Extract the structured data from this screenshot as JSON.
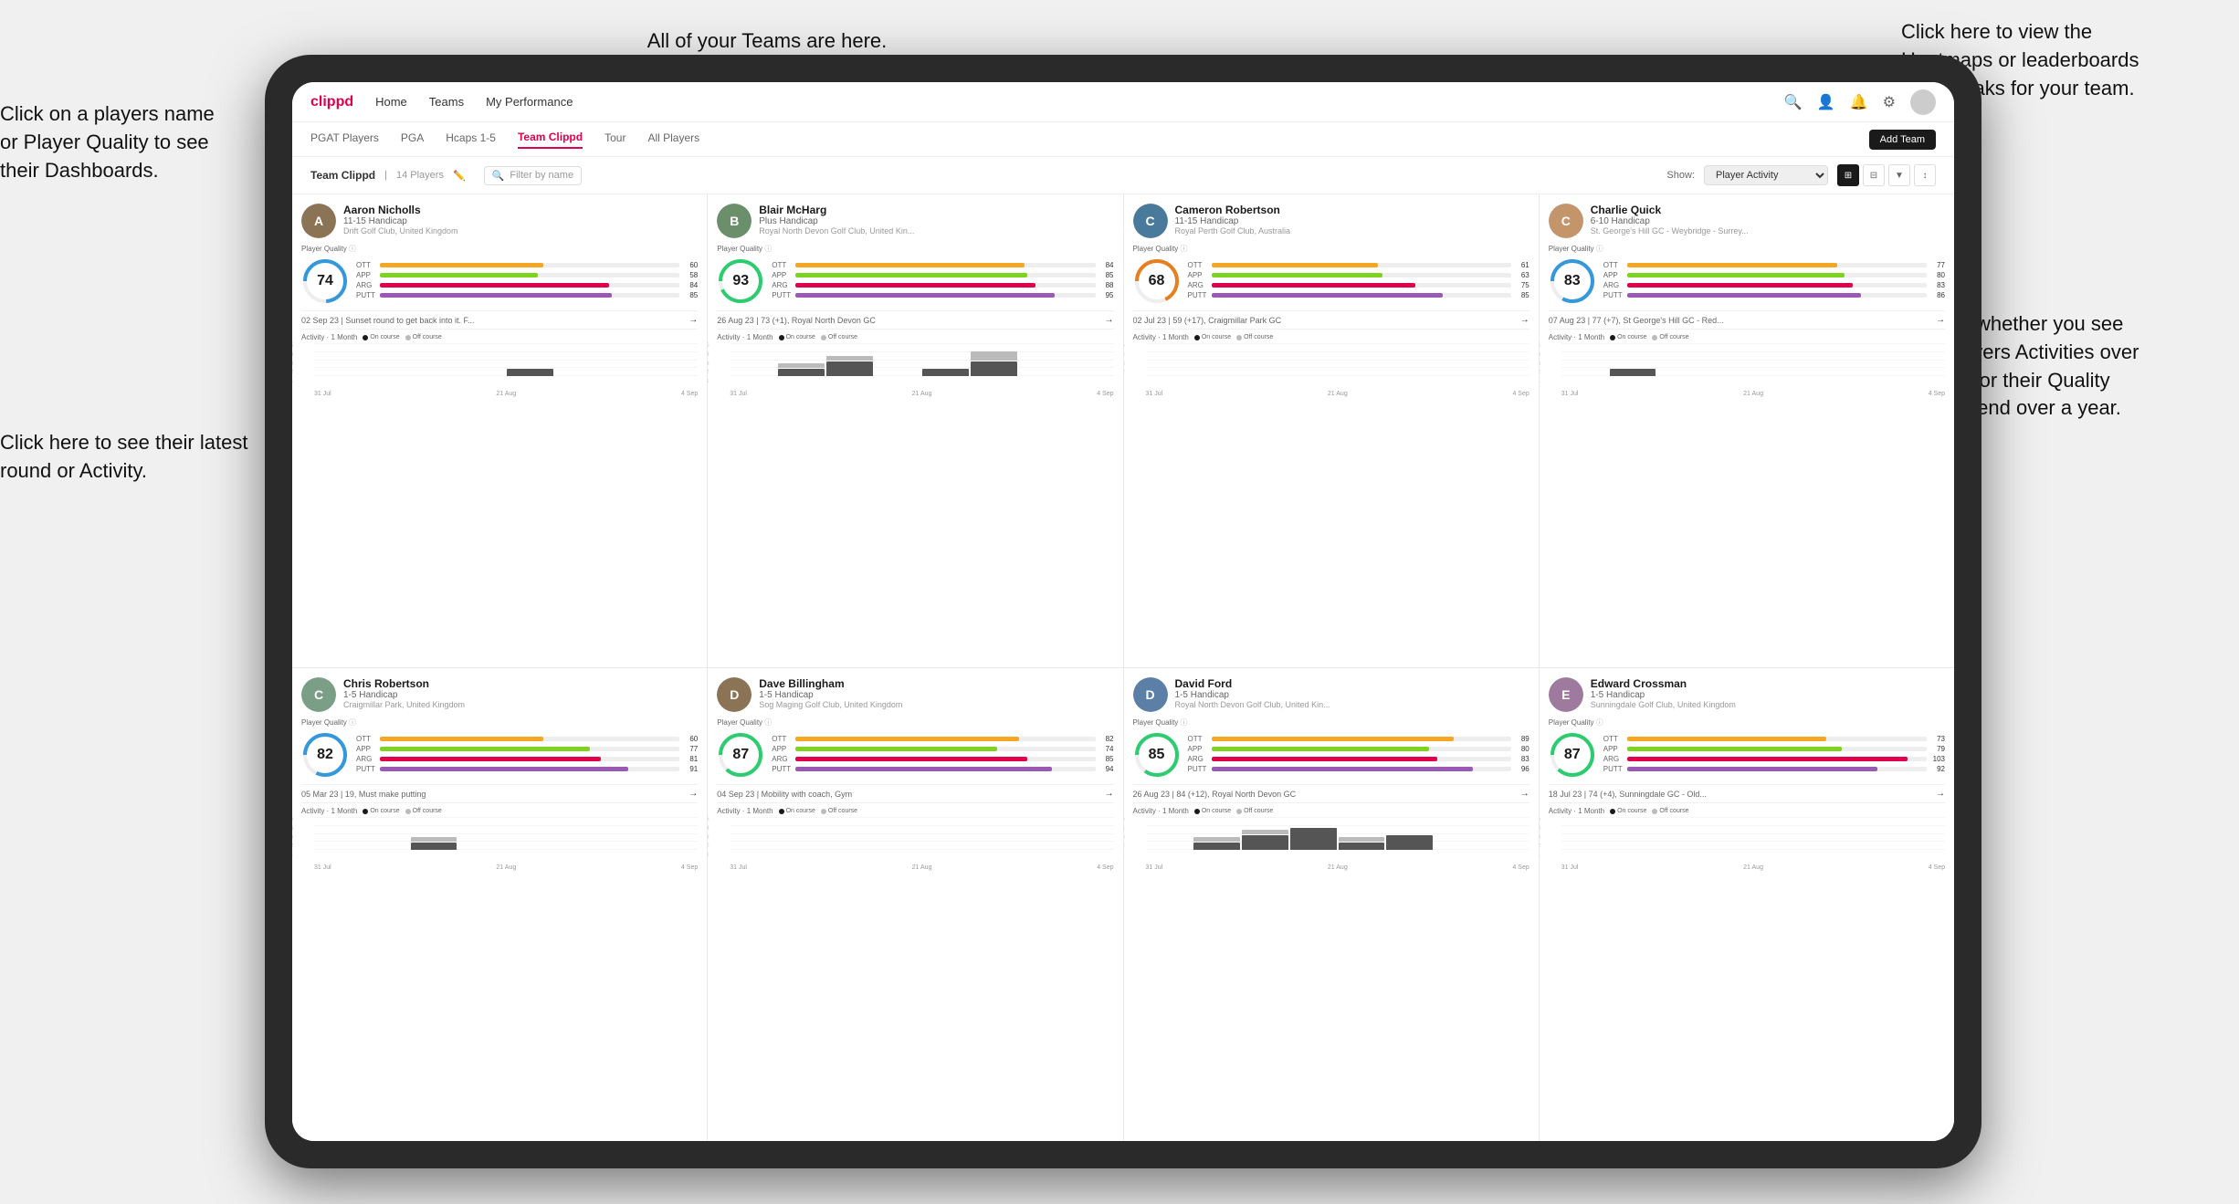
{
  "annotations": {
    "left1": "Click on a players name\nor Player Quality to see\ntheir Dashboards.",
    "left2": "Click here to see their latest\nround or Activity.",
    "top": "All of your Teams are here.",
    "topright": "Click here to view the\nHeatmaps or leaderboards\nand streaks for your team.",
    "right": "Choose whether you see\nyour players Activities over\na month or their Quality\nScore Trend over a year."
  },
  "nav": {
    "logo": "clippd",
    "items": [
      "Home",
      "Teams",
      "My Performance"
    ],
    "add_team": "Add Team"
  },
  "tabs": {
    "items": [
      "PGAT Players",
      "PGA",
      "Hcaps 1-5",
      "Team Clippd",
      "Tour",
      "All Players"
    ],
    "active": "Team Clippd"
  },
  "team_header": {
    "title": "Team Clippd",
    "count": "14 Players",
    "filter_placeholder": "Filter by name",
    "show_label": "Show:",
    "show_value": "Player Activity"
  },
  "players": [
    {
      "name": "Aaron Nicholls",
      "handicap": "11-15 Handicap",
      "club": "Drift Golf Club, United Kingdom",
      "quality": 74,
      "ott": 60,
      "app": 58,
      "arg": 84,
      "putt": 85,
      "latest_round": "02 Sep 23 | Sunset round to get back into it. F...",
      "bars": [
        {
          "week": "31 Jul",
          "on": 0,
          "off": 0
        },
        {
          "week": "",
          "on": 0,
          "off": 0
        },
        {
          "week": "",
          "on": 0,
          "off": 0
        },
        {
          "week": "",
          "on": 0,
          "off": 0
        },
        {
          "week": "",
          "on": 1,
          "off": 0
        },
        {
          "week": "21 Aug",
          "on": 0,
          "off": 0
        },
        {
          "week": "",
          "on": 0,
          "off": 0
        },
        {
          "week": "4 Sep",
          "on": 0,
          "off": 0
        }
      ],
      "avatar_color": "#8B7355"
    },
    {
      "name": "Blair McHarg",
      "handicap": "Plus Handicap",
      "club": "Royal North Devon Golf Club, United Kin...",
      "quality": 93,
      "ott": 84,
      "app": 85,
      "arg": 88,
      "putt": 95,
      "latest_round": "26 Aug 23 | 73 (+1), Royal North Devon GC",
      "bars": [
        {
          "week": "31 Jul",
          "on": 0,
          "off": 0
        },
        {
          "week": "",
          "on": 1,
          "off": 1
        },
        {
          "week": "",
          "on": 2,
          "off": 1
        },
        {
          "week": "",
          "on": 0,
          "off": 0
        },
        {
          "week": "",
          "on": 1,
          "off": 0
        },
        {
          "week": "21 Aug",
          "on": 2,
          "off": 2
        },
        {
          "week": "",
          "on": 0,
          "off": 0
        },
        {
          "week": "4 Sep",
          "on": 0,
          "off": 0
        }
      ],
      "avatar_color": "#6B8E6B"
    },
    {
      "name": "Cameron Robertson",
      "handicap": "11-15 Handicap",
      "club": "Royal Perth Golf Club, Australia",
      "quality": 68,
      "ott": 61,
      "app": 63,
      "arg": 75,
      "putt": 85,
      "latest_round": "02 Jul 23 | 59 (+17), Craigmillar Park GC",
      "bars": [
        {
          "week": "31 Jul",
          "on": 0,
          "off": 0
        },
        {
          "week": "",
          "on": 0,
          "off": 0
        },
        {
          "week": "",
          "on": 0,
          "off": 0
        },
        {
          "week": "",
          "on": 0,
          "off": 0
        },
        {
          "week": "",
          "on": 0,
          "off": 0
        },
        {
          "week": "21 Aug",
          "on": 0,
          "off": 0
        },
        {
          "week": "",
          "on": 0,
          "off": 0
        },
        {
          "week": "4 Sep",
          "on": 0,
          "off": 0
        }
      ],
      "avatar_color": "#4A7A9B"
    },
    {
      "name": "Charlie Quick",
      "handicap": "6-10 Handicap",
      "club": "St. George's Hill GC - Weybridge - Surrey...",
      "quality": 83,
      "ott": 77,
      "app": 80,
      "arg": 83,
      "putt": 86,
      "latest_round": "07 Aug 23 | 77 (+7), St George's Hill GC - Red...",
      "bars": [
        {
          "week": "31 Jul",
          "on": 0,
          "off": 0
        },
        {
          "week": "",
          "on": 1,
          "off": 0
        },
        {
          "week": "",
          "on": 0,
          "off": 0
        },
        {
          "week": "",
          "on": 0,
          "off": 0
        },
        {
          "week": "",
          "on": 0,
          "off": 0
        },
        {
          "week": "21 Aug",
          "on": 0,
          "off": 0
        },
        {
          "week": "",
          "on": 0,
          "off": 0
        },
        {
          "week": "4 Sep",
          "on": 0,
          "off": 0
        }
      ],
      "avatar_color": "#C4956A"
    },
    {
      "name": "Chris Robertson",
      "handicap": "1-5 Handicap",
      "club": "Craigmillar Park, United Kingdom",
      "quality": 82,
      "ott": 60,
      "app": 77,
      "arg": 81,
      "putt": 91,
      "latest_round": "05 Mar 23 | 19, Must make putting",
      "bars": [
        {
          "week": "31 Jul",
          "on": 0,
          "off": 0
        },
        {
          "week": "",
          "on": 0,
          "off": 0
        },
        {
          "week": "",
          "on": 1,
          "off": 1
        },
        {
          "week": "",
          "on": 0,
          "off": 0
        },
        {
          "week": "",
          "on": 0,
          "off": 0
        },
        {
          "week": "21 Aug",
          "on": 0,
          "off": 0
        },
        {
          "week": "",
          "on": 0,
          "off": 0
        },
        {
          "week": "4 Sep",
          "on": 0,
          "off": 0
        }
      ],
      "avatar_color": "#7B9E87"
    },
    {
      "name": "Dave Billingham",
      "handicap": "1-5 Handicap",
      "club": "Sog Maging Golf Club, United Kingdom",
      "quality": 87,
      "ott": 82,
      "app": 74,
      "arg": 85,
      "putt": 94,
      "latest_round": "04 Sep 23 | Mobility with coach, Gym",
      "bars": [
        {
          "week": "31 Jul",
          "on": 0,
          "off": 0
        },
        {
          "week": "",
          "on": 0,
          "off": 0
        },
        {
          "week": "",
          "on": 0,
          "off": 0
        },
        {
          "week": "",
          "on": 0,
          "off": 0
        },
        {
          "week": "",
          "on": 0,
          "off": 0
        },
        {
          "week": "21 Aug",
          "on": 0,
          "off": 0
        },
        {
          "week": "",
          "on": 0,
          "off": 0
        },
        {
          "week": "4 Sep",
          "on": 0,
          "off": 0
        }
      ],
      "avatar_color": "#8B7355"
    },
    {
      "name": "David Ford",
      "handicap": "1-5 Handicap",
      "club": "Royal North Devon Golf Club, United Kin...",
      "quality": 85,
      "ott": 89,
      "app": 80,
      "arg": 83,
      "putt": 96,
      "latest_round": "26 Aug 23 | 84 (+12), Royal North Devon GC",
      "bars": [
        {
          "week": "31 Jul",
          "on": 0,
          "off": 0
        },
        {
          "week": "",
          "on": 1,
          "off": 1
        },
        {
          "week": "",
          "on": 2,
          "off": 1
        },
        {
          "week": "",
          "on": 3,
          "off": 0
        },
        {
          "week": "",
          "on": 1,
          "off": 1
        },
        {
          "week": "21 Aug",
          "on": 2,
          "off": 0
        },
        {
          "week": "",
          "on": 0,
          "off": 0
        },
        {
          "week": "4 Sep",
          "on": 0,
          "off": 0
        }
      ],
      "avatar_color": "#5B7FA6"
    },
    {
      "name": "Edward Crossman",
      "handicap": "1-5 Handicap",
      "club": "Sunningdale Golf Club, United Kingdom",
      "quality": 87,
      "ott": 73,
      "app": 79,
      "arg": 103,
      "putt": 92,
      "latest_round": "18 Jul 23 | 74 (+4), Sunningdale GC - Old...",
      "bars": [
        {
          "week": "31 Jul",
          "on": 0,
          "off": 0
        },
        {
          "week": "",
          "on": 0,
          "off": 0
        },
        {
          "week": "",
          "on": 0,
          "off": 0
        },
        {
          "week": "",
          "on": 0,
          "off": 0
        },
        {
          "week": "",
          "on": 0,
          "off": 0
        },
        {
          "week": "21 Aug",
          "on": 0,
          "off": 0
        },
        {
          "week": "",
          "on": 0,
          "off": 0
        },
        {
          "week": "4 Sep",
          "on": 0,
          "off": 0
        }
      ],
      "avatar_color": "#9E7B9E"
    }
  ]
}
